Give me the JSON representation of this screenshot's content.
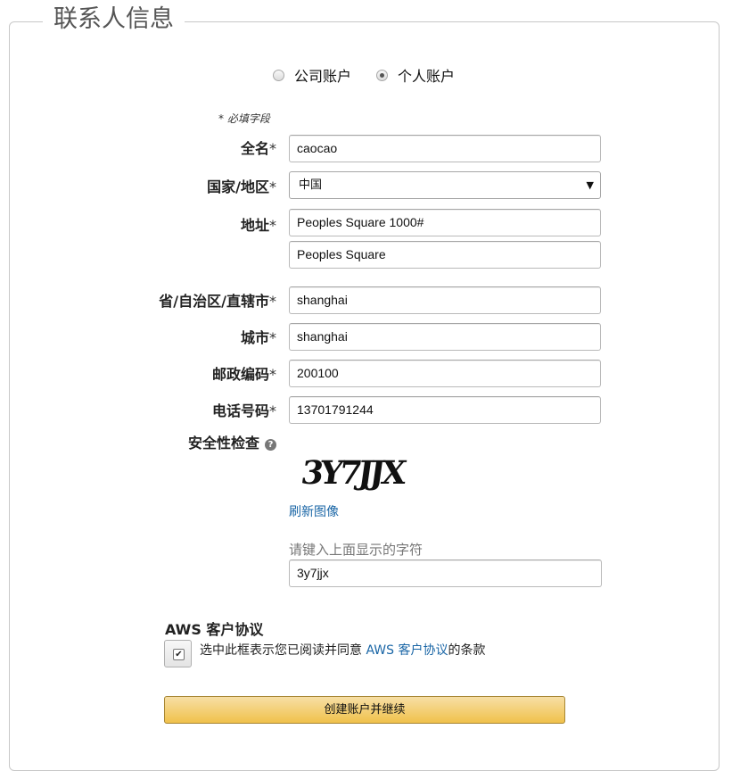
{
  "legend": "联系人信息",
  "account_type": {
    "options": [
      {
        "label": "公司账户",
        "checked": false
      },
      {
        "label": "个人账户",
        "checked": true
      }
    ]
  },
  "required_note": "* 必填字段",
  "required_marker": "*",
  "fields": {
    "full_name": {
      "label": "全名",
      "value": "caocao"
    },
    "country": {
      "label": "国家/地区",
      "value": "中国"
    },
    "address": {
      "label": "地址",
      "line1": "Peoples Square 1000#",
      "line2": "Peoples Square"
    },
    "province": {
      "label": "省/自治区/直辖市",
      "value": "shanghai"
    },
    "city": {
      "label": "城市",
      "value": "shanghai"
    },
    "postal_code": {
      "label": "邮政编码",
      "value": "200100"
    },
    "phone": {
      "label": "电话号码",
      "value": "13701791244"
    }
  },
  "security": {
    "label": "安全性检查",
    "help_icon": "question-circle-icon",
    "captcha_text": "3Y7JJX",
    "refresh_label": "刷新图像",
    "hint": "请键入上面显示的字符",
    "value": "3y7jjx"
  },
  "agreement": {
    "title": "AWS 客户协议",
    "checked": true,
    "text_before": "选中此框表示您已阅读并同意 ",
    "link_text": "AWS 客户协议",
    "text_after": "的条款"
  },
  "submit_label": "创建账户并继续",
  "colors": {
    "link": "#1a66a6",
    "button_top": "#f7dfa5",
    "button_bottom": "#f0c14b",
    "border": "#c8c8c8"
  }
}
